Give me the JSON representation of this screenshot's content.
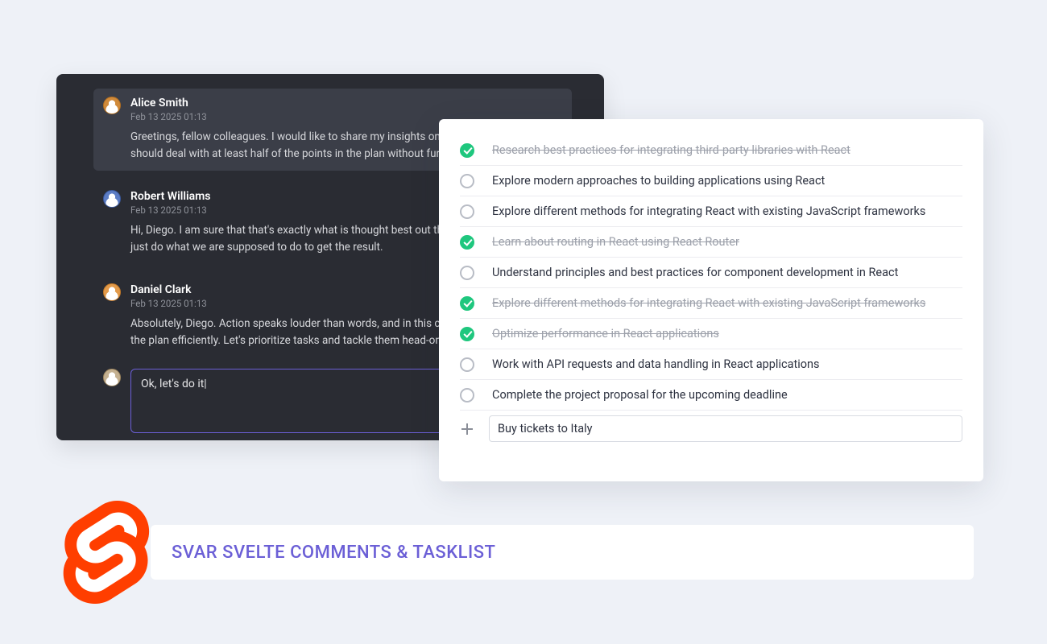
{
  "comments": [
    {
      "author": "Alice Smith",
      "ts": "Feb 13 2025 01:13",
      "msg": "Greetings, fellow colleagues. I would like to share my insights on this task. I reckon we should deal with at least half of the points in the plan without further delays."
    },
    {
      "author": "Robert Williams",
      "ts": "Feb 13 2025 01:13",
      "msg": "Hi, Diego. I am sure that that's exactly what is thought best out there in general. Let us just do what we are supposed to do to get the result."
    },
    {
      "author": "Daniel Clark",
      "ts": "Feb 13 2025 01:13",
      "msg": "Absolutely, Diego. Action speaks louder than words, and in this case, it's about executing the plan efficiently. Let's prioritize tasks and tackle them head-on."
    }
  ],
  "compose_value": "Ok, let's do it|",
  "tasks": [
    {
      "done": true,
      "text": "Research best practices for integrating third-party libraries with React"
    },
    {
      "done": false,
      "text": "Explore modern approaches to building applications using React"
    },
    {
      "done": false,
      "text": "Explore different methods for integrating React with existing JavaScript frameworks"
    },
    {
      "done": true,
      "text": "Learn about routing in React using React Router"
    },
    {
      "done": false,
      "text": "Understand principles and best practices for component development in React"
    },
    {
      "done": true,
      "text": "Explore different methods for integrating React with existing JavaScript frameworks"
    },
    {
      "done": true,
      "text": "Optimize performance in React applications"
    },
    {
      "done": false,
      "text": "Work with API requests and data handling in React applications"
    },
    {
      "done": false,
      "text": "Complete the project proposal for the upcoming deadline"
    }
  ],
  "new_task_value": "Buy tickets to Italy",
  "banner": "SVAR  SVELTE COMMENTS & TASKLIST"
}
